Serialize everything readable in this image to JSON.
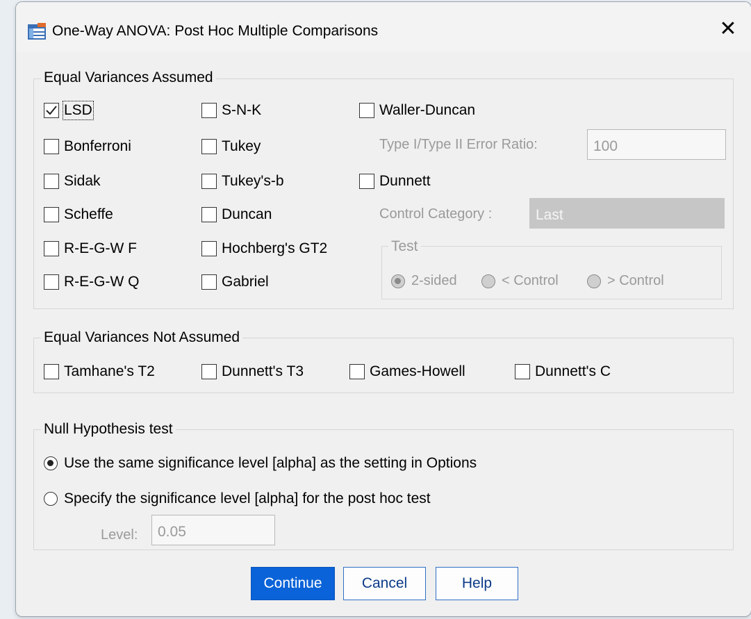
{
  "window": {
    "title": "One-Way ANOVA: Post Hoc Multiple Comparisons",
    "close_glyph": "✕"
  },
  "equal_assumed": {
    "legend": "Equal Variances Assumed",
    "col1": [
      "LSD",
      "Bonferroni",
      "Sidak",
      "Scheffe",
      "R-E-G-W F",
      "R-E-G-W Q"
    ],
    "col2": [
      "S-N-K",
      "Tukey",
      "Tukey's-b",
      "Duncan",
      "Hochberg's GT2",
      "Gabriel"
    ],
    "waller_duncan": "Waller-Duncan",
    "error_ratio_label": "Type I/Type II Error Ratio:",
    "error_ratio_value": "100",
    "dunnett": "Dunnett",
    "control_category_label": "Control Category :",
    "control_category_value": "Last",
    "test_legend": "Test",
    "test_options": [
      "2-sided",
      "< Control",
      "> Control"
    ],
    "checked": [
      "LSD"
    ]
  },
  "equal_not_assumed": {
    "legend": "Equal Variances Not Assumed",
    "items": [
      "Tamhane's T2",
      "Dunnett's T3",
      "Games-Howell",
      "Dunnett's C"
    ]
  },
  "null_hypothesis": {
    "legend": "Null Hypothesis test",
    "option_same": "Use the same significance level [alpha] as the setting in Options",
    "option_specify": "Specify the significance level [alpha] for the post hoc test",
    "level_label": "Level:",
    "level_value": "0.05",
    "selected": "same"
  },
  "buttons": {
    "continue": "Continue",
    "cancel": "Cancel",
    "help": "Help"
  },
  "colors": {
    "primary_button": "#0a63d8",
    "disabled_text": "#9a9a9a"
  }
}
